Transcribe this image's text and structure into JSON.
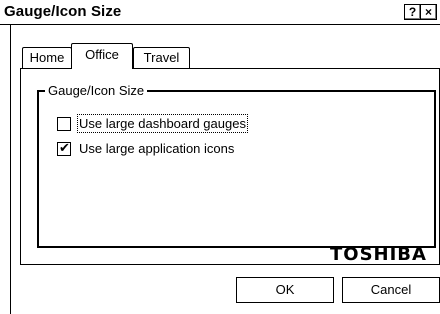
{
  "window": {
    "title": "Gauge/Icon Size",
    "help_button": "?",
    "close_button": "×"
  },
  "tabs": [
    {
      "label": "Home"
    },
    {
      "label": "Office",
      "selected": true
    },
    {
      "label": "Travel"
    }
  ],
  "group": {
    "label": "Gauge/Icon Size",
    "options": [
      {
        "label": "Use large dashboard gauges",
        "checked": false
      },
      {
        "label": "Use large application icons",
        "checked": true
      }
    ]
  },
  "logo": "TOSHIBA",
  "buttons": {
    "ok": "OK",
    "cancel": "Cancel"
  }
}
